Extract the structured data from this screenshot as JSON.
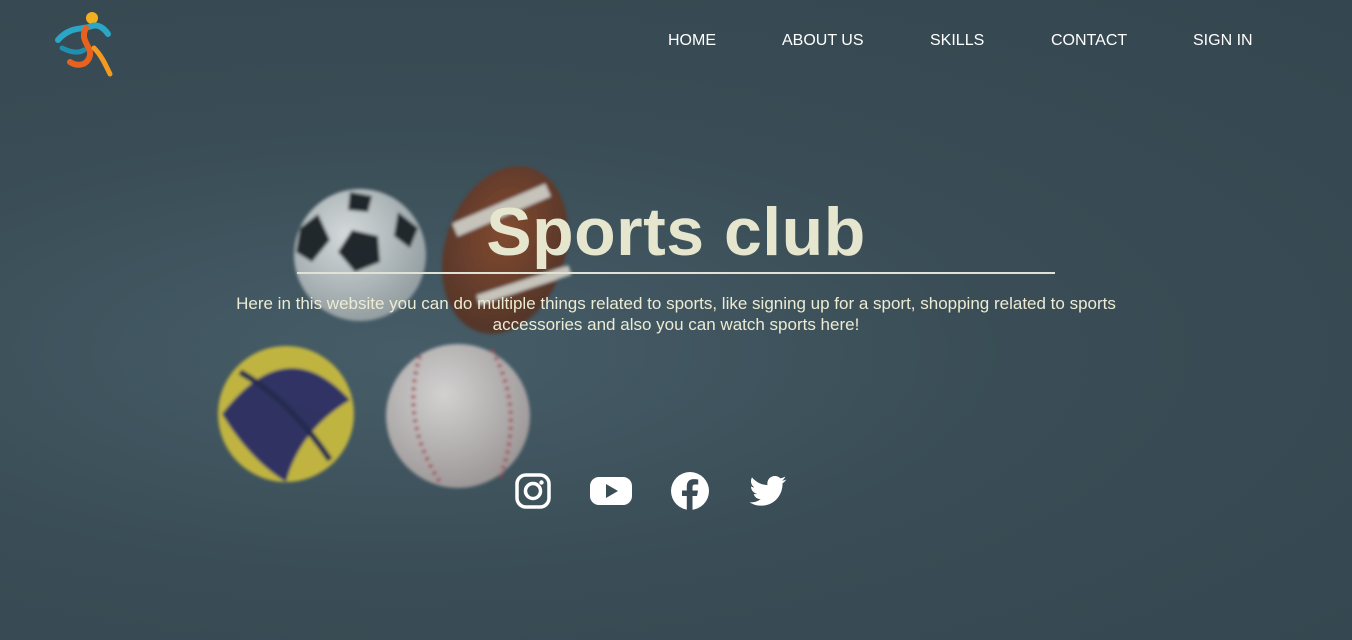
{
  "nav": {
    "items": [
      {
        "label": "HOME"
      },
      {
        "label": "ABOUT US"
      },
      {
        "label": "SKILLS"
      },
      {
        "label": "CONTACT"
      },
      {
        "label": "SIGN IN"
      }
    ]
  },
  "hero": {
    "title": "Sports club",
    "description": "Here in this website you can do multiple things related to sports, like signing up for a sport, shopping related to sports accessories and also you can watch sports here!"
  },
  "social": {
    "icons": [
      "instagram-icon",
      "youtube-icon",
      "facebook-icon",
      "twitter-icon"
    ]
  },
  "colors": {
    "background": "#3a4c55",
    "title": "#e6e6cf",
    "text": "#ecebd3",
    "nav_text": "#ffffff"
  }
}
